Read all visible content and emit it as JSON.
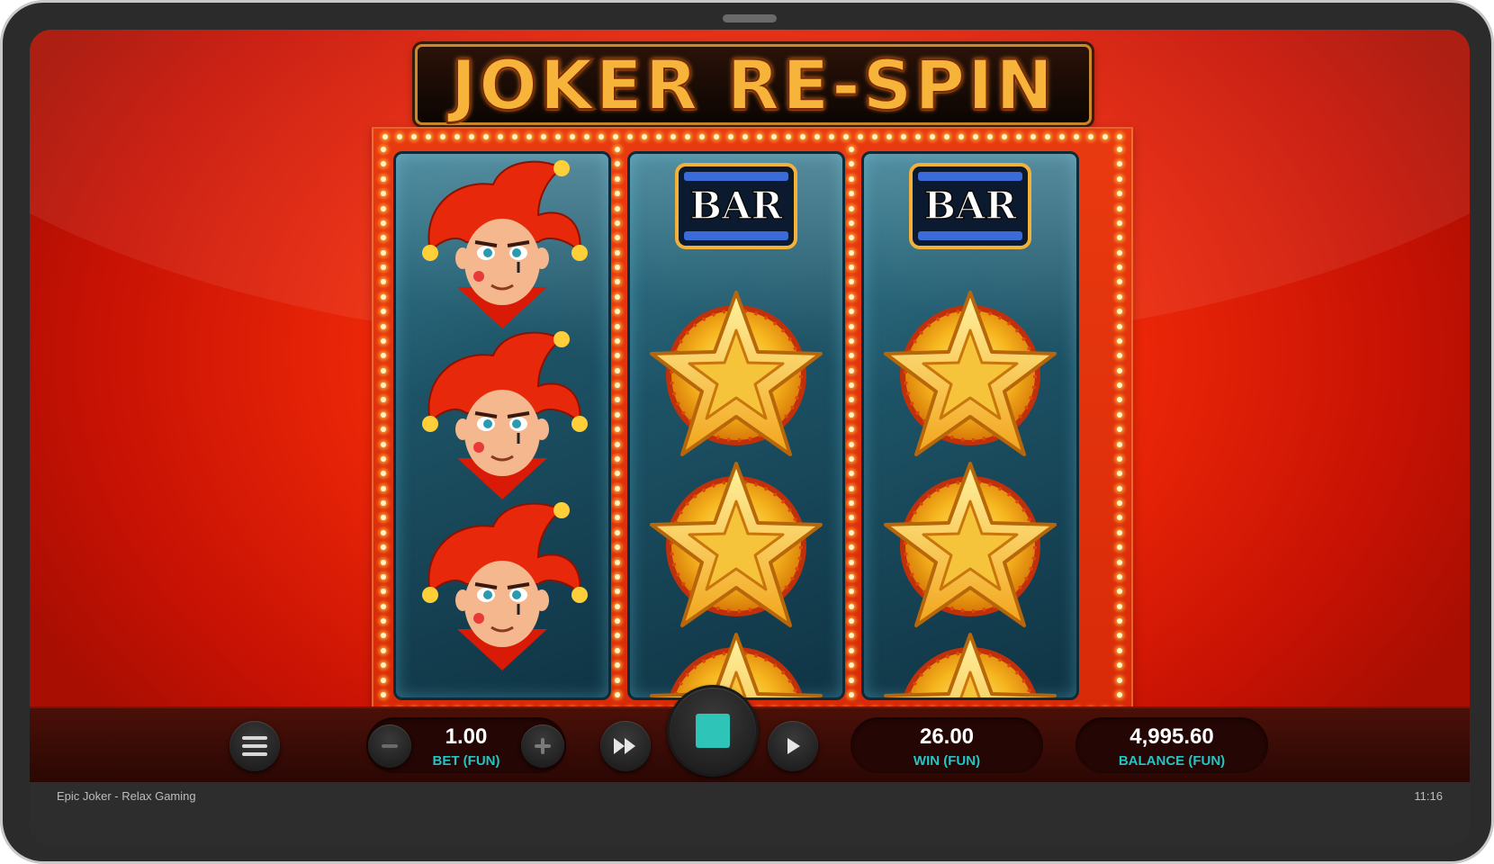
{
  "game": {
    "logo_text": "JOKER RE-SPIN",
    "footer_title": "Epic Joker - Relax Gaming",
    "clock": "11:16"
  },
  "reels": [
    {
      "symbols": [
        "joker",
        "joker",
        "joker"
      ]
    },
    {
      "symbols": [
        "bar",
        "star",
        "star",
        "star-partial"
      ],
      "bar_text": "BAR"
    },
    {
      "symbols": [
        "bar",
        "star",
        "star",
        "star-partial"
      ],
      "bar_text": "BAR"
    }
  ],
  "controls": {
    "menu_icon": "hamburger-menu-icon",
    "bet": {
      "value": "1.00",
      "label": "BET (FUN)"
    },
    "win": {
      "value": "26.00",
      "label": "WIN (FUN)"
    },
    "balance": {
      "value": "4,995.60",
      "label": "BALANCE (FUN)"
    },
    "minus_icon": "minus-icon",
    "plus_icon": "plus-icon",
    "fast_forward_icon": "fast-forward-icon",
    "stop_icon": "stop-icon",
    "autoplay_icon": "play-icon"
  },
  "colors": {
    "accent_teal": "#27c3c3",
    "background_red": "#ee2808",
    "logo_gold": "#f6b53a"
  }
}
